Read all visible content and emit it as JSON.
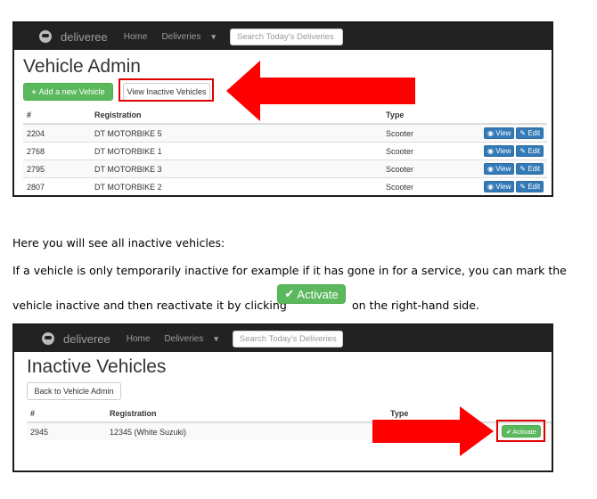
{
  "app": {
    "brand": "deliveree",
    "nav": {
      "home": "Home",
      "deliveries": "Deliveries",
      "chevron": "▾"
    },
    "search_placeholder": "Search Today's Deliveries"
  },
  "vehicle_admin": {
    "title": "Vehicle Admin",
    "add_button": "Add a new Vehicle",
    "view_inactive_button": "View Inactive Vehicles",
    "columns": [
      "#",
      "Registration",
      "Type"
    ],
    "view_label": "View",
    "edit_label": "Edit",
    "rows": [
      {
        "id": "2204",
        "registration": "DT MOTORBIKE 5",
        "type": "Scooter"
      },
      {
        "id": "2768",
        "registration": "DT MOTORBIKE 1",
        "type": "Scooter"
      },
      {
        "id": "2795",
        "registration": "DT MOTORBIKE 3",
        "type": "Scooter"
      },
      {
        "id": "2807",
        "registration": "DT MOTORBIKE 2",
        "type": "Scooter"
      }
    ]
  },
  "instructions": {
    "line1": "Here you will see all inactive vehicles:",
    "line2": "If a vehicle is only temporarily inactive for example if it has gone in for a service, you can mark the",
    "line3a": "vehicle inactive and then reactivate it by clicking",
    "activate_label": "Activate",
    "line3b": "on the right-hand side."
  },
  "inactive_vehicles": {
    "title": "Inactive Vehicles",
    "back_button": "Back to Vehicle Admin",
    "columns": [
      "#",
      "Registration",
      "Type"
    ],
    "activate_label": "Activate",
    "rows": [
      {
        "id": "2945",
        "registration": "12345 (White Suzuki)",
        "type": ""
      }
    ]
  },
  "colors": {
    "highlight": "#e00000",
    "success": "#5cb85c",
    "primary": "#337ab7",
    "navbar": "#222222"
  }
}
